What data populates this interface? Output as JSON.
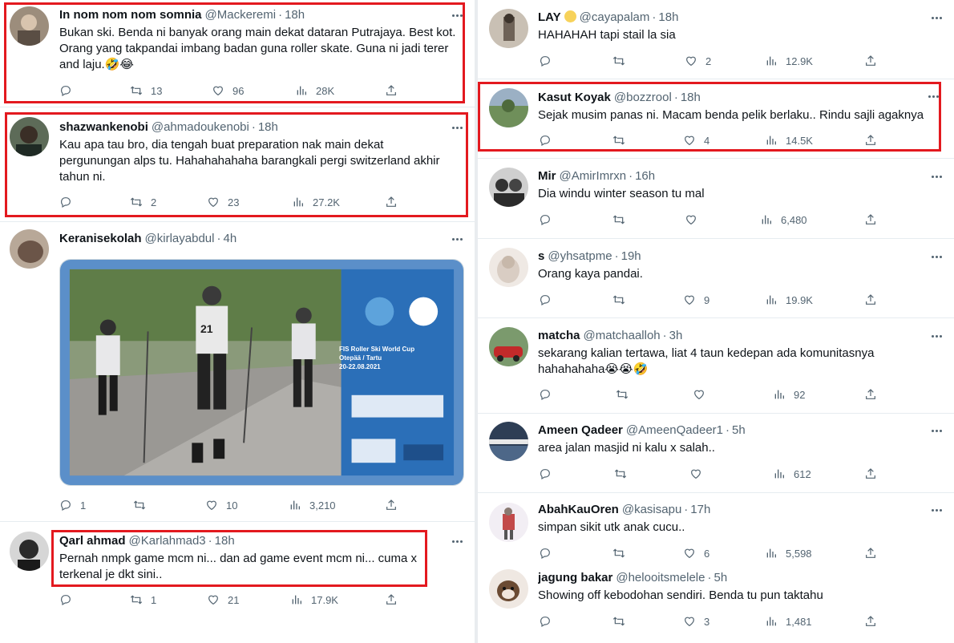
{
  "left": {
    "tweets": [
      {
        "name": "In nom nom nom somnia",
        "handle": "@Mackeremi",
        "time": "18h",
        "text": "Bukan ski. Benda ni banyak orang main dekat dataran Putrajaya. Best kot.\nOrang yang takpandai imbang badan guna roller skate. Guna ni jadi terer\nand laju.🤣😂",
        "replies": "",
        "retweets": "13",
        "likes": "96",
        "views": "28K",
        "avatar_color": "#7d6a5c"
      },
      {
        "name": "shazwankenobi",
        "handle": "@ahmadoukenobi",
        "time": "18h",
        "text": "Kau apa tau bro, dia tengah buat preparation nak main dekat\npergunungan alps tu. Hahahahahaha barangkali pergi switzerland akhir\ntahun ni.",
        "replies": "",
        "retweets": "2",
        "likes": "23",
        "views": "27.2K",
        "avatar_color": "#3b4a3f"
      },
      {
        "name": "Keranisekolah",
        "handle": "@kirlayabdul",
        "time": "4h",
        "text": "",
        "replies": "1",
        "retweets": "",
        "likes": "10",
        "views": "3,210",
        "avatar_color": "#8c7b6e",
        "media": {
          "title_line1": "FIS Roller Ski World Cup",
          "title_line2": "Otepää / Tartu",
          "title_line3": "20-22.08.2021",
          "bib": "21"
        }
      },
      {
        "name": "Qarl ahmad",
        "handle": "@Karlahmad3",
        "time": "18h",
        "text": "Pernah nmpk game mcm ni... dan ad game event mcm ni... cuma x\nterkenal je dkt sini..",
        "replies": "",
        "retweets": "1",
        "likes": "21",
        "views": "17.9K",
        "avatar_color": "#2a2a2a"
      }
    ]
  },
  "right": {
    "tweets": [
      {
        "name": "LAY",
        "handle": "@cayapalam",
        "time": "18h",
        "text": "HAHAHAH tapi stail la sia",
        "replies": "",
        "retweets": "",
        "likes": "2",
        "views": "12.9K",
        "avatar_color": "#a89a8a"
      },
      {
        "name": "Kasut Koyak",
        "handle": "@bozzrool",
        "time": "18h",
        "text": "Sejak musim panas ni. Macam benda pelik berlaku.. Rindu sajli agaknya",
        "replies": "",
        "retweets": "",
        "likes": "4",
        "views": "14.5K",
        "avatar_color": "#6f8f5a"
      },
      {
        "name": "Mir",
        "handle": "@AmirImrxn",
        "time": "16h",
        "text": "Dia windu winter season tu mal",
        "replies": "",
        "retweets": "",
        "likes": "",
        "views": "6,480",
        "avatar_color": "#3d3d3d"
      },
      {
        "name": "s",
        "handle": "@yhsatpme",
        "time": "19h",
        "text": "Orang kaya pandai.",
        "replies": "",
        "retweets": "",
        "likes": "9",
        "views": "19.9K",
        "avatar_color": "#d9cfc8"
      },
      {
        "name": "matcha",
        "handle": "@matchaalloh",
        "time": "3h",
        "text": "sekarang kalian tertawa, liat 4 taun kedepan ada komunitasnya\nhahahahaha😭😭🤣",
        "replies": "",
        "retweets": "",
        "likes": "",
        "views": "92",
        "avatar_color": "#4f6b4a"
      },
      {
        "name": "Ameen Qadeer",
        "handle": "@AmeenQadeer1",
        "time": "5h",
        "text": "area jalan masjid ni kalu x salah..",
        "replies": "",
        "retweets": "",
        "likes": "",
        "views": "612",
        "avatar_color": "#2f3f55"
      },
      {
        "name": "AbahKauOren",
        "handle": "@kasisapu",
        "time": "17h",
        "text": "simpan sikit utk anak cucu..",
        "replies": "",
        "retweets": "",
        "likes": "6",
        "views": "5,598",
        "avatar_color": "#e9e4ec"
      },
      {
        "name": "jagung bakar",
        "handle": "@helooitsmelele",
        "time": "5h",
        "text": "Showing off kebodohan sendiri. Benda tu pun taktahu",
        "replies": "",
        "retweets": "",
        "likes": "3",
        "views": "1,481",
        "avatar_color": "#8b6b4a"
      }
    ]
  },
  "colors": {
    "highlight": "#e3191f",
    "secondary_text": "#536471",
    "separator": "#e6ecf0"
  },
  "icons": [
    "reply-icon",
    "retweet-icon",
    "like-icon",
    "views-icon",
    "share-icon",
    "more-icon"
  ]
}
